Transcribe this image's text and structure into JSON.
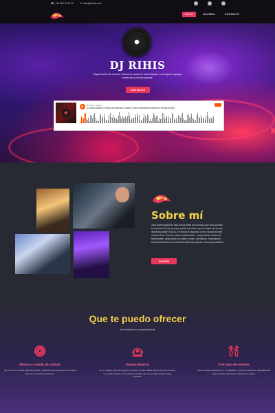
{
  "topbar": {
    "phone": "+34 663 27 58 00",
    "email": "info@dj-rihis.com",
    "socials": [
      "facebook-icon",
      "instagram-icon",
      "soundcloud-icon"
    ],
    "nav": [
      {
        "label": "INICIO",
        "active": true
      },
      {
        "label": "GALERÍA",
        "active": false
      },
      {
        "label": "CONTACTO",
        "active": false
      }
    ]
  },
  "hero": {
    "title": "DJ RIHIS",
    "subtitle": "Organización de eventos, fiestas de bodas en toda España. Los mejores equipos modernos y música popular.",
    "button": "CONTACTO",
    "arrow": "›"
  },
  "player": {
    "play": "▶",
    "artist": "DJ Rihis_seidner",
    "track": "DJ Rihis seidner • Radio sin Estrenos Limited | Techno Dancethon Radio en PLIN(14/2022)"
  },
  "about": {
    "title": "Sobre mí",
    "text": "¡Una parte integral de toda buena fiesta es la música que crea grandes emociones! ¡Es por eso que puede escuchar a que tu fiesta sea la más divertida posible! Soy DJ, he tenido la dispuesto con la música durante muchos años. Toco en varias celebraciones : cumpleaños, noches de bachelorette, despedidas de soltero, bodas, discotecas, restaurantes, bares ofreciendo a tus ocasiones diversas mejores emociones posibles!",
    "button": "GALERÍA"
  },
  "services": {
    "title": "Que te puedo ofrecer",
    "subtitle": "mis fortalezas y características",
    "items": [
      {
        "title": "Música y sonido de calidad",
        "text": "Soy un DJ con mucha años de práctica y entiendo cómo debe sonar la música para crear ambiente de alzarse."
      },
      {
        "title": "Equipo Musical",
        "text": "En mi trabajo, solo uso equipos musicales de alta calidad. Esto le da a los eventos un sonido exquisito. Y los efectos geniales dan nueva vida a mayor fiestas populares."
      },
      {
        "title": "Todo tipo de eventos",
        "text": "Toco en varias celebraciones : cumpleaños, noches de bachelor, despedidas de soltero, bodas, discotecas, restaurantes, bares."
      }
    ]
  },
  "colors": {
    "accent": "#e8375c",
    "yellow": "#f6d24a",
    "dark": "#272a33"
  }
}
